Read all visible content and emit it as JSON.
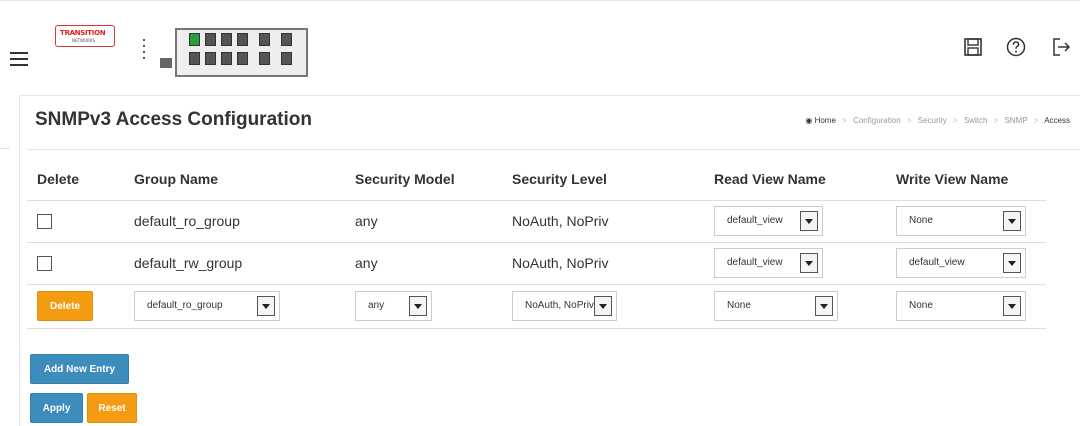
{
  "header": {
    "logo_line1": "TRANSITION",
    "logo_line2": "NETWORKS",
    "icons": [
      "menu-icon",
      "save-icon",
      "help-icon",
      "logout-icon"
    ]
  },
  "page": {
    "title": "SNMPv3 Access Configuration"
  },
  "breadcrumb": {
    "items": [
      "Home",
      "Configuration",
      "Security",
      "Switch",
      "SNMP",
      "Access"
    ],
    "separator": ">"
  },
  "table": {
    "headers": [
      "Delete",
      "Group Name",
      "Security Model",
      "Security Level",
      "Read View Name",
      "Write View Name"
    ],
    "rows": [
      {
        "group_name": "default_ro_group",
        "security_model": "any",
        "security_level": "NoAuth, NoPriv",
        "read_view": "default_view",
        "write_view": "None"
      },
      {
        "group_name": "default_rw_group",
        "security_model": "any",
        "security_level": "NoAuth, NoPriv",
        "read_view": "default_view",
        "write_view": "default_view"
      }
    ],
    "new_row": {
      "delete_label": "Delete",
      "group_name": "default_ro_group",
      "security_model": "any",
      "security_level": "NoAuth, NoPriv",
      "read_view": "None",
      "write_view": "None"
    }
  },
  "buttons": {
    "add_new_entry": "Add New Entry",
    "apply": "Apply",
    "reset": "Reset"
  },
  "colors": {
    "orange": "#f39c12",
    "blue": "#3c8dbc",
    "port_up": "#2a9d3a"
  }
}
